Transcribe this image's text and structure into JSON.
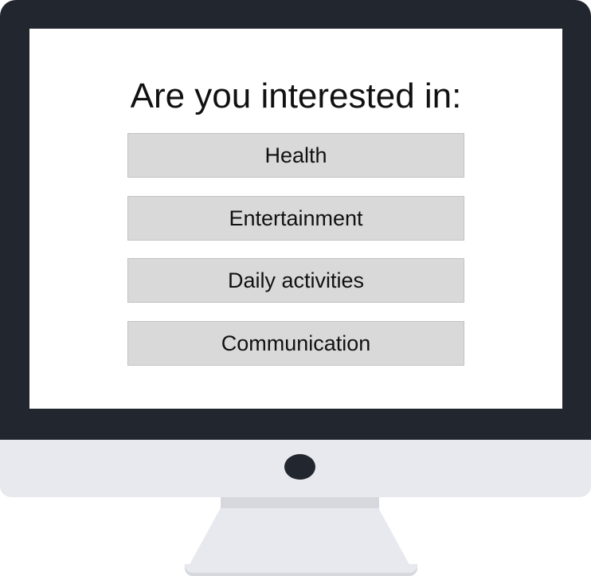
{
  "screen": {
    "question": "Are you interested in:",
    "options": [
      {
        "label": "Health"
      },
      {
        "label": "Entertainment"
      },
      {
        "label": "Daily activities"
      },
      {
        "label": "Communication"
      }
    ]
  },
  "colors": {
    "bezel": "#22262f",
    "chin": "#e7e9ee",
    "option_background": "#d9d9d9",
    "screen_background": "#ffffff"
  }
}
